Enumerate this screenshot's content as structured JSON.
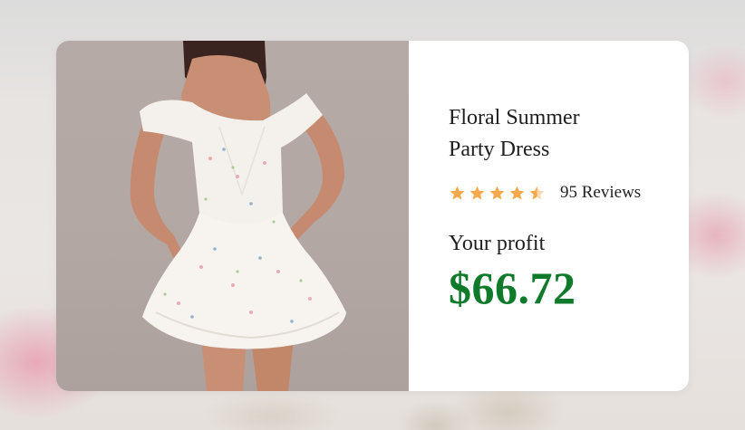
{
  "product": {
    "title_line1": "Floral Summer",
    "title_line2": "Party Dress",
    "rating": 4.5,
    "reviews_label": "95 Reviews",
    "profit_label": "Your profit",
    "profit_value": "$66.72"
  },
  "colors": {
    "star": "#f5a94a",
    "profit": "#0f7a2a",
    "text": "#1e1e1e"
  },
  "icons": {
    "star": "star-icon",
    "half_star": "half-star-icon"
  }
}
